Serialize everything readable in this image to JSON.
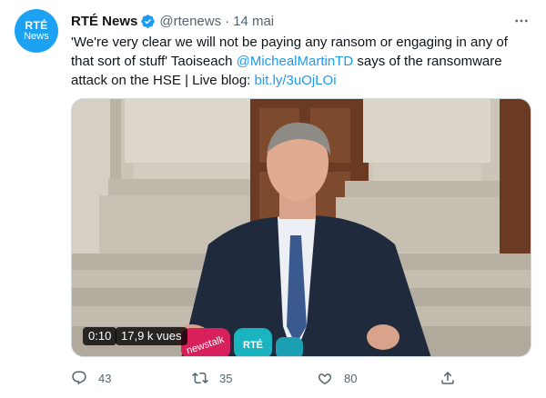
{
  "tweet": {
    "avatar": {
      "line1": "RTÉ",
      "line2": "News"
    },
    "author_name": "RTÉ News",
    "handle": "@rtenews",
    "separator": "·",
    "date": "14 mai",
    "text_before": "'We're very clear we will not be paying any ransom or engaging in any of that sort of stuff' Taoiseach ",
    "mention": "@MichealMartinTD",
    "text_middle": " says of the ransomware attack on the HSE | Live blog: ",
    "link": "bit.ly/3uOjLOi",
    "video": {
      "elapsed": "0:10",
      "views": "17,9 k vues",
      "mic_label_1": "newstalk",
      "mic_label_2": "RTÉ"
    },
    "actions": {
      "replies": "43",
      "retweets": "35",
      "likes": "80"
    }
  },
  "colors": {
    "accent": "#1d9bf0",
    "text": "#0f1419",
    "muted": "#536471",
    "avatar_bg": "#1da1f2"
  },
  "icons": [
    "verified-badge-icon",
    "more-icon",
    "reply-icon",
    "retweet-icon",
    "like-icon",
    "share-icon"
  ]
}
